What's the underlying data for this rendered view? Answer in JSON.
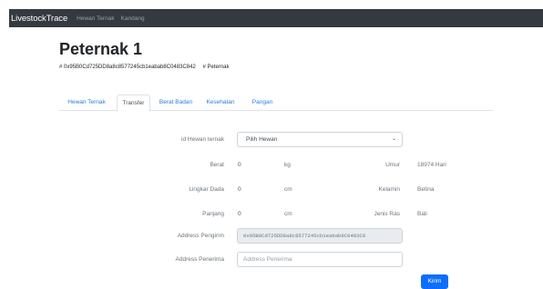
{
  "navbar": {
    "brand": "LivestockTrace",
    "links": [
      "Hewan Ternak",
      "Kandang"
    ]
  },
  "header": {
    "title": "Peternak 1",
    "address": "# 0x95B0Cd725DD8a8c8577245cb1eabab8C0483C842",
    "role": "# Peternak"
  },
  "tabs": [
    "Hewan Ternak",
    "Transfer",
    "Berat Badan",
    "Kesehatan",
    "Pangan"
  ],
  "active_tab": "Transfer",
  "form": {
    "id_hewan_label": "id Hewan ternak",
    "id_hewan_selected": "Pilih Hewan",
    "berat_label": "Berat",
    "berat_value": "0",
    "berat_unit": "kg",
    "umur_label": "Umur",
    "umur_value": "18974 Hari",
    "lingkar_label": "Lingkar Dada",
    "lingkar_value": "0",
    "lingkar_unit": "cm",
    "kelamin_label": "Kelamin",
    "kelamin_value": "Betina",
    "panjang_label": "Panjang",
    "panjang_value": "0",
    "panjang_unit": "cm",
    "jenis_label": "Jenis Ras",
    "jenis_value": "Bali",
    "pengirim_label": "Address Pengirim",
    "pengirim_value": "0x95B0Cd725DD8a8c8577245cb1eabab8C0483C8",
    "penerima_label": "Address Penerima",
    "penerima_placeholder": "Address Penerima",
    "submit_label": "Kirim"
  },
  "colors": {
    "navbar": "#343a40",
    "link": "#2a7de1",
    "primary": "#0d6efd"
  }
}
